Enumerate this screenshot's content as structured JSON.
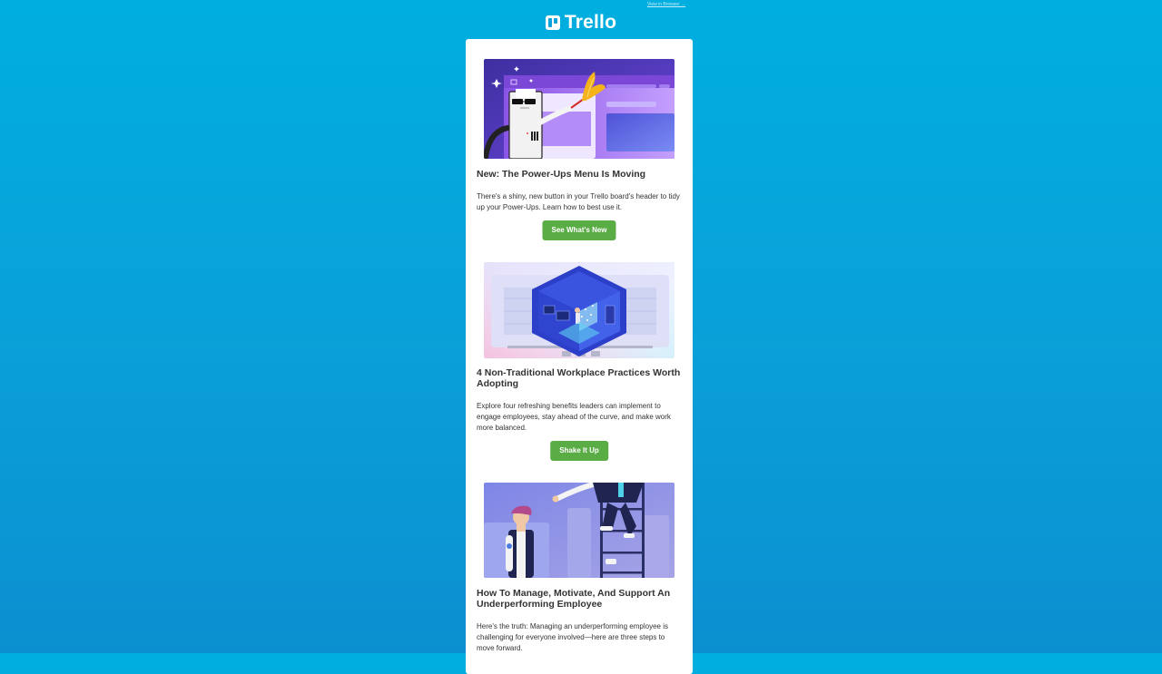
{
  "header": {
    "view_in_browser": "View in Browser →",
    "logo_text": "Trello"
  },
  "articles": [
    {
      "title": "New: The Power-Ups Menu Is Moving",
      "description": "There's a shiny, new button in your Trello board's header to tidy up your Power-Ups. Learn how to best use it.",
      "button": "See What's New"
    },
    {
      "title": "4 Non-Traditional Workplace Practices Worth Adopting",
      "description": "Explore four refreshing benefits leaders can implement to engage employees, stay ahead of the curve, and make work more balanced.",
      "button": "Shake It Up"
    },
    {
      "title": "How To Manage, Motivate, And Support An Underperforming Employee",
      "description": "Here's the truth: Managing an underperforming employee is challenging for everyone involved—here are three steps to move forward."
    }
  ],
  "colors": {
    "background": "#00AEDF",
    "button": "#5AAC44",
    "card": "#FFFFFF"
  }
}
